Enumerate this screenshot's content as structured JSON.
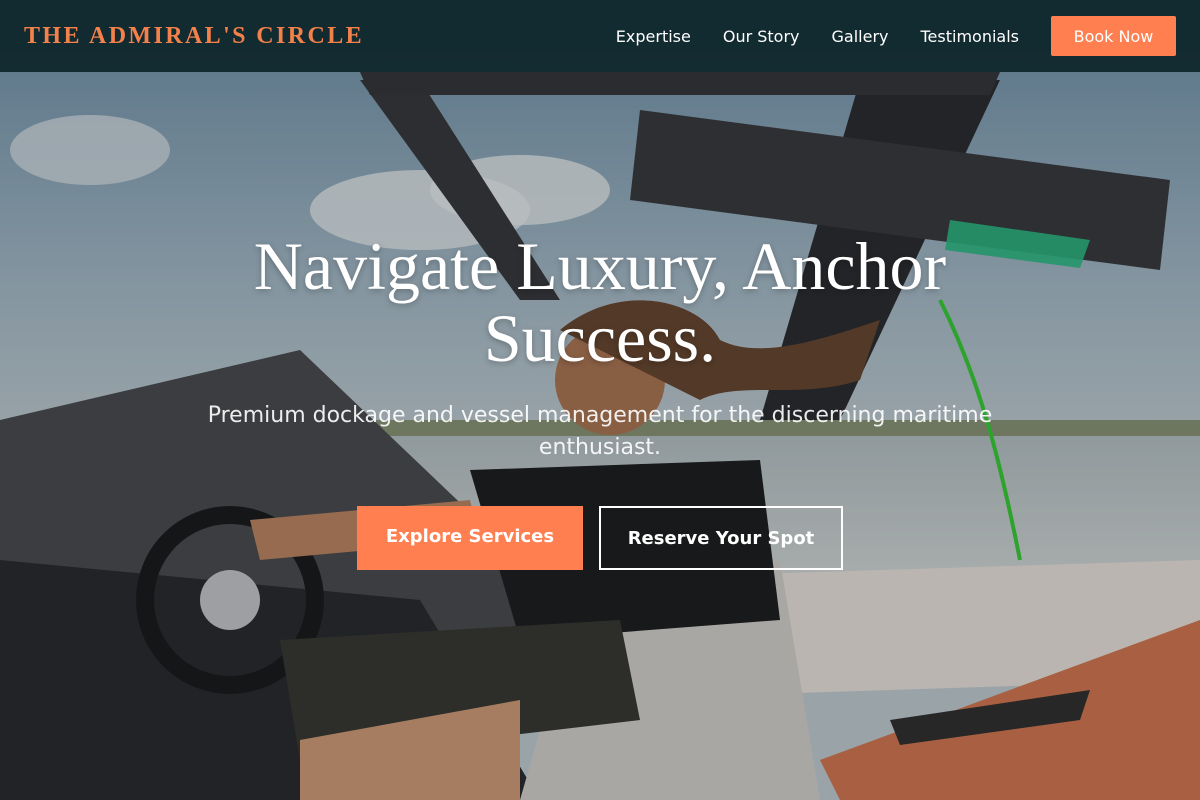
{
  "nav": {
    "brand": "THE ADMIRAL'S CIRCLE",
    "links": [
      "Expertise",
      "Our Story",
      "Gallery",
      "Testimonials"
    ],
    "cta_label": "Book Now"
  },
  "hero": {
    "title": "Navigate Luxury, Anchor Success.",
    "subtitle": "Premium dockage and vessel management for the discerning maritime enthusiast.",
    "primary_button": "Explore Services",
    "secondary_button": "Reserve Your Spot",
    "image": "hero-photo-man-driving-wakeboard-boat"
  },
  "colors": {
    "accent": "#ff7f50",
    "brand_text": "#f4804a",
    "nav_background": "#0d262a",
    "text_light": "#ffffff"
  }
}
